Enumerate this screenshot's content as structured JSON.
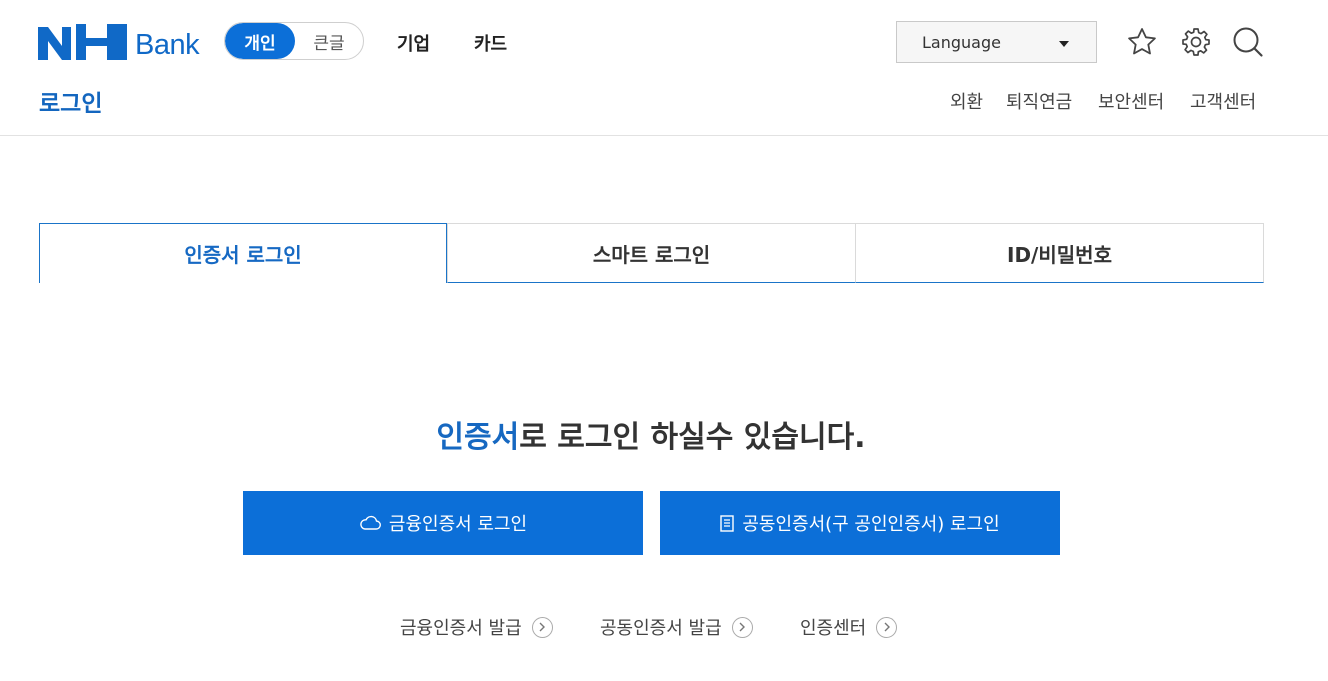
{
  "brand": {
    "text": "Bank",
    "mark": "NH"
  },
  "segment": {
    "active": "개인",
    "inactive": "큰글"
  },
  "gnb": [
    "기업",
    "카드"
  ],
  "language": {
    "label": "Language"
  },
  "header_icons": [
    "star-icon",
    "gear-icon",
    "search-icon"
  ],
  "page_title": "로그인",
  "util_links": [
    "외환",
    "퇴직연금",
    "보안센터",
    "고객센터"
  ],
  "tabs": [
    "인증서 로그인",
    "스마트 로그인",
    "ID/비밀번호"
  ],
  "headline": {
    "highlight": "인증서",
    "rest": "로 로그인 하실수 있습니다."
  },
  "buttons": {
    "financial": {
      "label": "금융인증서 로그인",
      "icon": "cloud-icon"
    },
    "joint": {
      "label": "공동인증서(구 공인인증서) 로그인",
      "icon": "document-icon"
    }
  },
  "links": [
    "금융인증서 발급",
    "공동인증서 발급",
    "인증센터"
  ],
  "colors": {
    "primary": "#0c6fd8",
    "brand_blue": "#1069c7",
    "text": "#333333"
  }
}
